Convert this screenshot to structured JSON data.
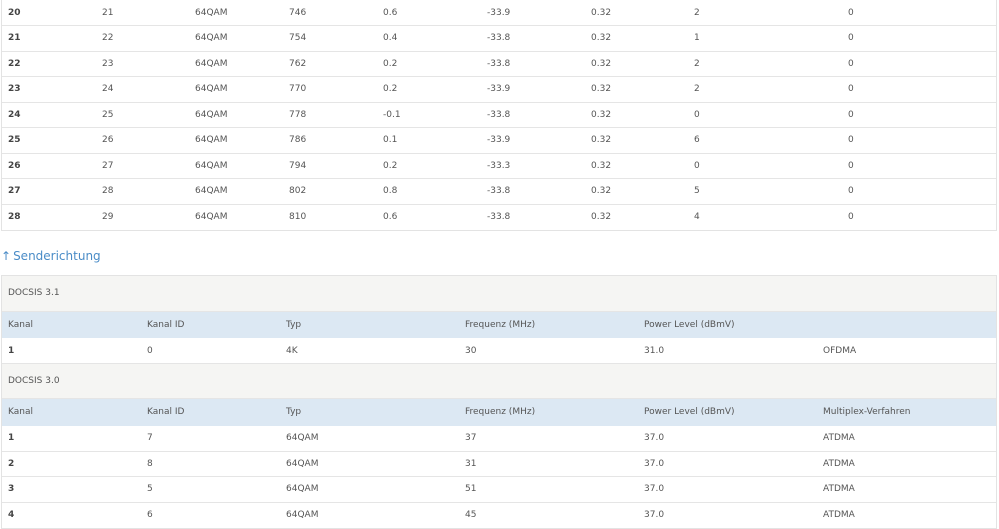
{
  "downstream": {
    "rows": [
      {
        "kanal": "20",
        "kanal_id": "21",
        "typ": "64QAM",
        "frequenz": "746",
        "power": "0.6",
        "mse": "-33.9",
        "latenz": "0.32",
        "korr": "2",
        "nicht_korr": "0"
      },
      {
        "kanal": "21",
        "kanal_id": "22",
        "typ": "64QAM",
        "frequenz": "754",
        "power": "0.4",
        "mse": "-33.8",
        "latenz": "0.32",
        "korr": "1",
        "nicht_korr": "0"
      },
      {
        "kanal": "22",
        "kanal_id": "23",
        "typ": "64QAM",
        "frequenz": "762",
        "power": "0.2",
        "mse": "-33.8",
        "latenz": "0.32",
        "korr": "2",
        "nicht_korr": "0"
      },
      {
        "kanal": "23",
        "kanal_id": "24",
        "typ": "64QAM",
        "frequenz": "770",
        "power": "0.2",
        "mse": "-33.9",
        "latenz": "0.32",
        "korr": "2",
        "nicht_korr": "0"
      },
      {
        "kanal": "24",
        "kanal_id": "25",
        "typ": "64QAM",
        "frequenz": "778",
        "power": "-0.1",
        "mse": "-33.8",
        "latenz": "0.32",
        "korr": "0",
        "nicht_korr": "0"
      },
      {
        "kanal": "25",
        "kanal_id": "26",
        "typ": "64QAM",
        "frequenz": "786",
        "power": "0.1",
        "mse": "-33.9",
        "latenz": "0.32",
        "korr": "6",
        "nicht_korr": "0"
      },
      {
        "kanal": "26",
        "kanal_id": "27",
        "typ": "64QAM",
        "frequenz": "794",
        "power": "0.2",
        "mse": "-33.3",
        "latenz": "0.32",
        "korr": "0",
        "nicht_korr": "0"
      },
      {
        "kanal": "27",
        "kanal_id": "28",
        "typ": "64QAM",
        "frequenz": "802",
        "power": "0.8",
        "mse": "-33.8",
        "latenz": "0.32",
        "korr": "5",
        "nicht_korr": "0"
      },
      {
        "kanal": "28",
        "kanal_id": "29",
        "typ": "64QAM",
        "frequenz": "810",
        "power": "0.6",
        "mse": "-33.8",
        "latenz": "0.32",
        "korr": "4",
        "nicht_korr": "0"
      }
    ]
  },
  "upstream": {
    "heading_arrow": "↑",
    "heading": "Senderichtung",
    "docsis31": {
      "group_label": "DOCSIS 3.1",
      "headers": {
        "kanal": "Kanal",
        "kanal_id": "Kanal ID",
        "typ": "Typ",
        "frequenz": "Frequenz (MHz)",
        "power": "Power Level (dBmV)"
      },
      "rows": [
        {
          "kanal": "1",
          "kanal_id": "0",
          "typ": "4K",
          "frequenz": "30",
          "power": "31.0",
          "multiplex": "OFDMA"
        }
      ]
    },
    "docsis30": {
      "group_label": "DOCSIS 3.0",
      "headers": {
        "kanal": "Kanal",
        "kanal_id": "Kanal ID",
        "typ": "Typ",
        "frequenz": "Frequenz (MHz)",
        "power": "Power Level (dBmV)",
        "multiplex": "Multiplex-Verfahren"
      },
      "rows": [
        {
          "kanal": "1",
          "kanal_id": "7",
          "typ": "64QAM",
          "frequenz": "37",
          "power": "37.0",
          "multiplex": "ATDMA"
        },
        {
          "kanal": "2",
          "kanal_id": "8",
          "typ": "64QAM",
          "frequenz": "31",
          "power": "37.0",
          "multiplex": "ATDMA"
        },
        {
          "kanal": "3",
          "kanal_id": "5",
          "typ": "64QAM",
          "frequenz": "51",
          "power": "37.0",
          "multiplex": "ATDMA"
        },
        {
          "kanal": "4",
          "kanal_id": "6",
          "typ": "64QAM",
          "frequenz": "45",
          "power": "37.0",
          "multiplex": "ATDMA"
        }
      ]
    }
  }
}
